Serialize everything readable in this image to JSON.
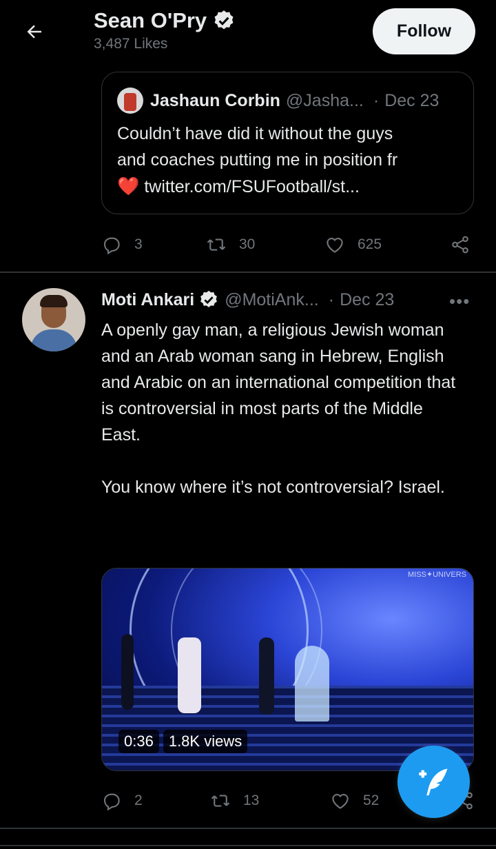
{
  "header": {
    "name": "Sean O'Pry",
    "likes": "3,487 Likes",
    "follow_label": "Follow"
  },
  "quote": {
    "name": "Jashaun Corbin",
    "handle": "@Jasha...",
    "dot": "·",
    "date": "Dec 23",
    "text_line1": "Couldn’t have did it without the guys",
    "text_line2": "and coaches putting me in position fr",
    "heart": "❤️",
    "link": "twitter.com/FSUFootball/st..."
  },
  "tweet1_actions": {
    "replies": "3",
    "retweets": "30",
    "likes": "625"
  },
  "tweet2": {
    "name": "Moti Ankari",
    "handle": "@MotiAnk...",
    "dot": "·",
    "date": "Dec 23",
    "more": "•••",
    "text": "A openly gay man, a religious Jewish woman and an Arab woman sang in Hebrew, English and Arabic on an international competition that is controversial in most parts of the Middle East.\n\nYou know where it’s not controversial? Israel.",
    "video": {
      "duration": "0:36",
      "views": "1.8K views",
      "watermark": "MISS✦UNIVERS"
    },
    "actions": {
      "replies": "2",
      "retweets": "13",
      "likes": "52"
    }
  },
  "colors": {
    "accent": "#1d9bf0",
    "muted": "#71767b",
    "text": "#e7e9ea",
    "border": "#2f3336"
  }
}
